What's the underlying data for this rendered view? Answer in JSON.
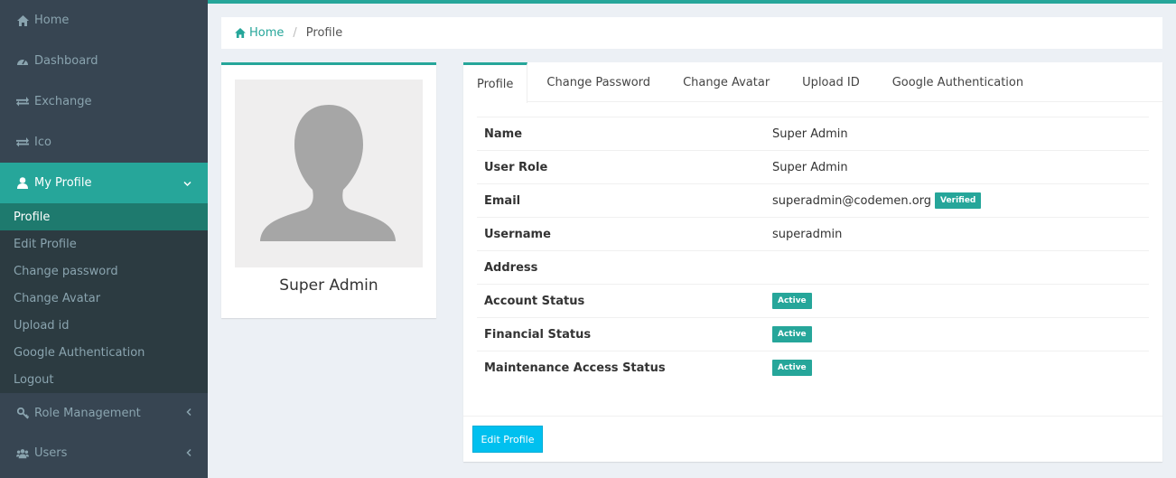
{
  "sidebar": {
    "items": [
      {
        "label": "Home",
        "icon": "home-icon"
      },
      {
        "label": "Dashboard",
        "icon": "dashboard-icon"
      },
      {
        "label": "Exchange",
        "icon": "exchange-icon"
      },
      {
        "label": "Ico",
        "icon": "exchange-icon"
      },
      {
        "label": "My Profile",
        "icon": "user-icon"
      }
    ],
    "submenu": [
      {
        "label": "Profile"
      },
      {
        "label": "Edit Profile"
      },
      {
        "label": "Change password"
      },
      {
        "label": "Change Avatar"
      },
      {
        "label": "Upload id"
      },
      {
        "label": "Google Authentication"
      },
      {
        "label": "Logout"
      }
    ],
    "after": [
      {
        "label": "Role Management",
        "icon": "key-icon"
      },
      {
        "label": "Users",
        "icon": "users-icon"
      }
    ]
  },
  "breadcrumb": {
    "home": "Home",
    "current": "Profile"
  },
  "profile_card": {
    "name": "Super Admin"
  },
  "tabs": [
    "Profile",
    "Change Password",
    "Change Avatar",
    "Upload ID",
    "Google Authentication"
  ],
  "details": [
    {
      "label": "Name",
      "value": "Super Admin",
      "badge": ""
    },
    {
      "label": "User Role",
      "value": "Super Admin",
      "badge": ""
    },
    {
      "label": "Email",
      "value": "superadmin@codemen.org",
      "badge": "Verified"
    },
    {
      "label": "Username",
      "value": "superadmin",
      "badge": ""
    },
    {
      "label": "Address",
      "value": "",
      "badge": ""
    },
    {
      "label": "Account Status",
      "value": "",
      "badge": "Active"
    },
    {
      "label": "Financial Status",
      "value": "",
      "badge": "Active"
    },
    {
      "label": "Maintenance Access Status",
      "value": "",
      "badge": "Active"
    }
  ],
  "edit_button": "Edit Profile",
  "colors": {
    "accent": "#26a69a",
    "sidebar": "#374552",
    "button": "#00c0ef"
  }
}
